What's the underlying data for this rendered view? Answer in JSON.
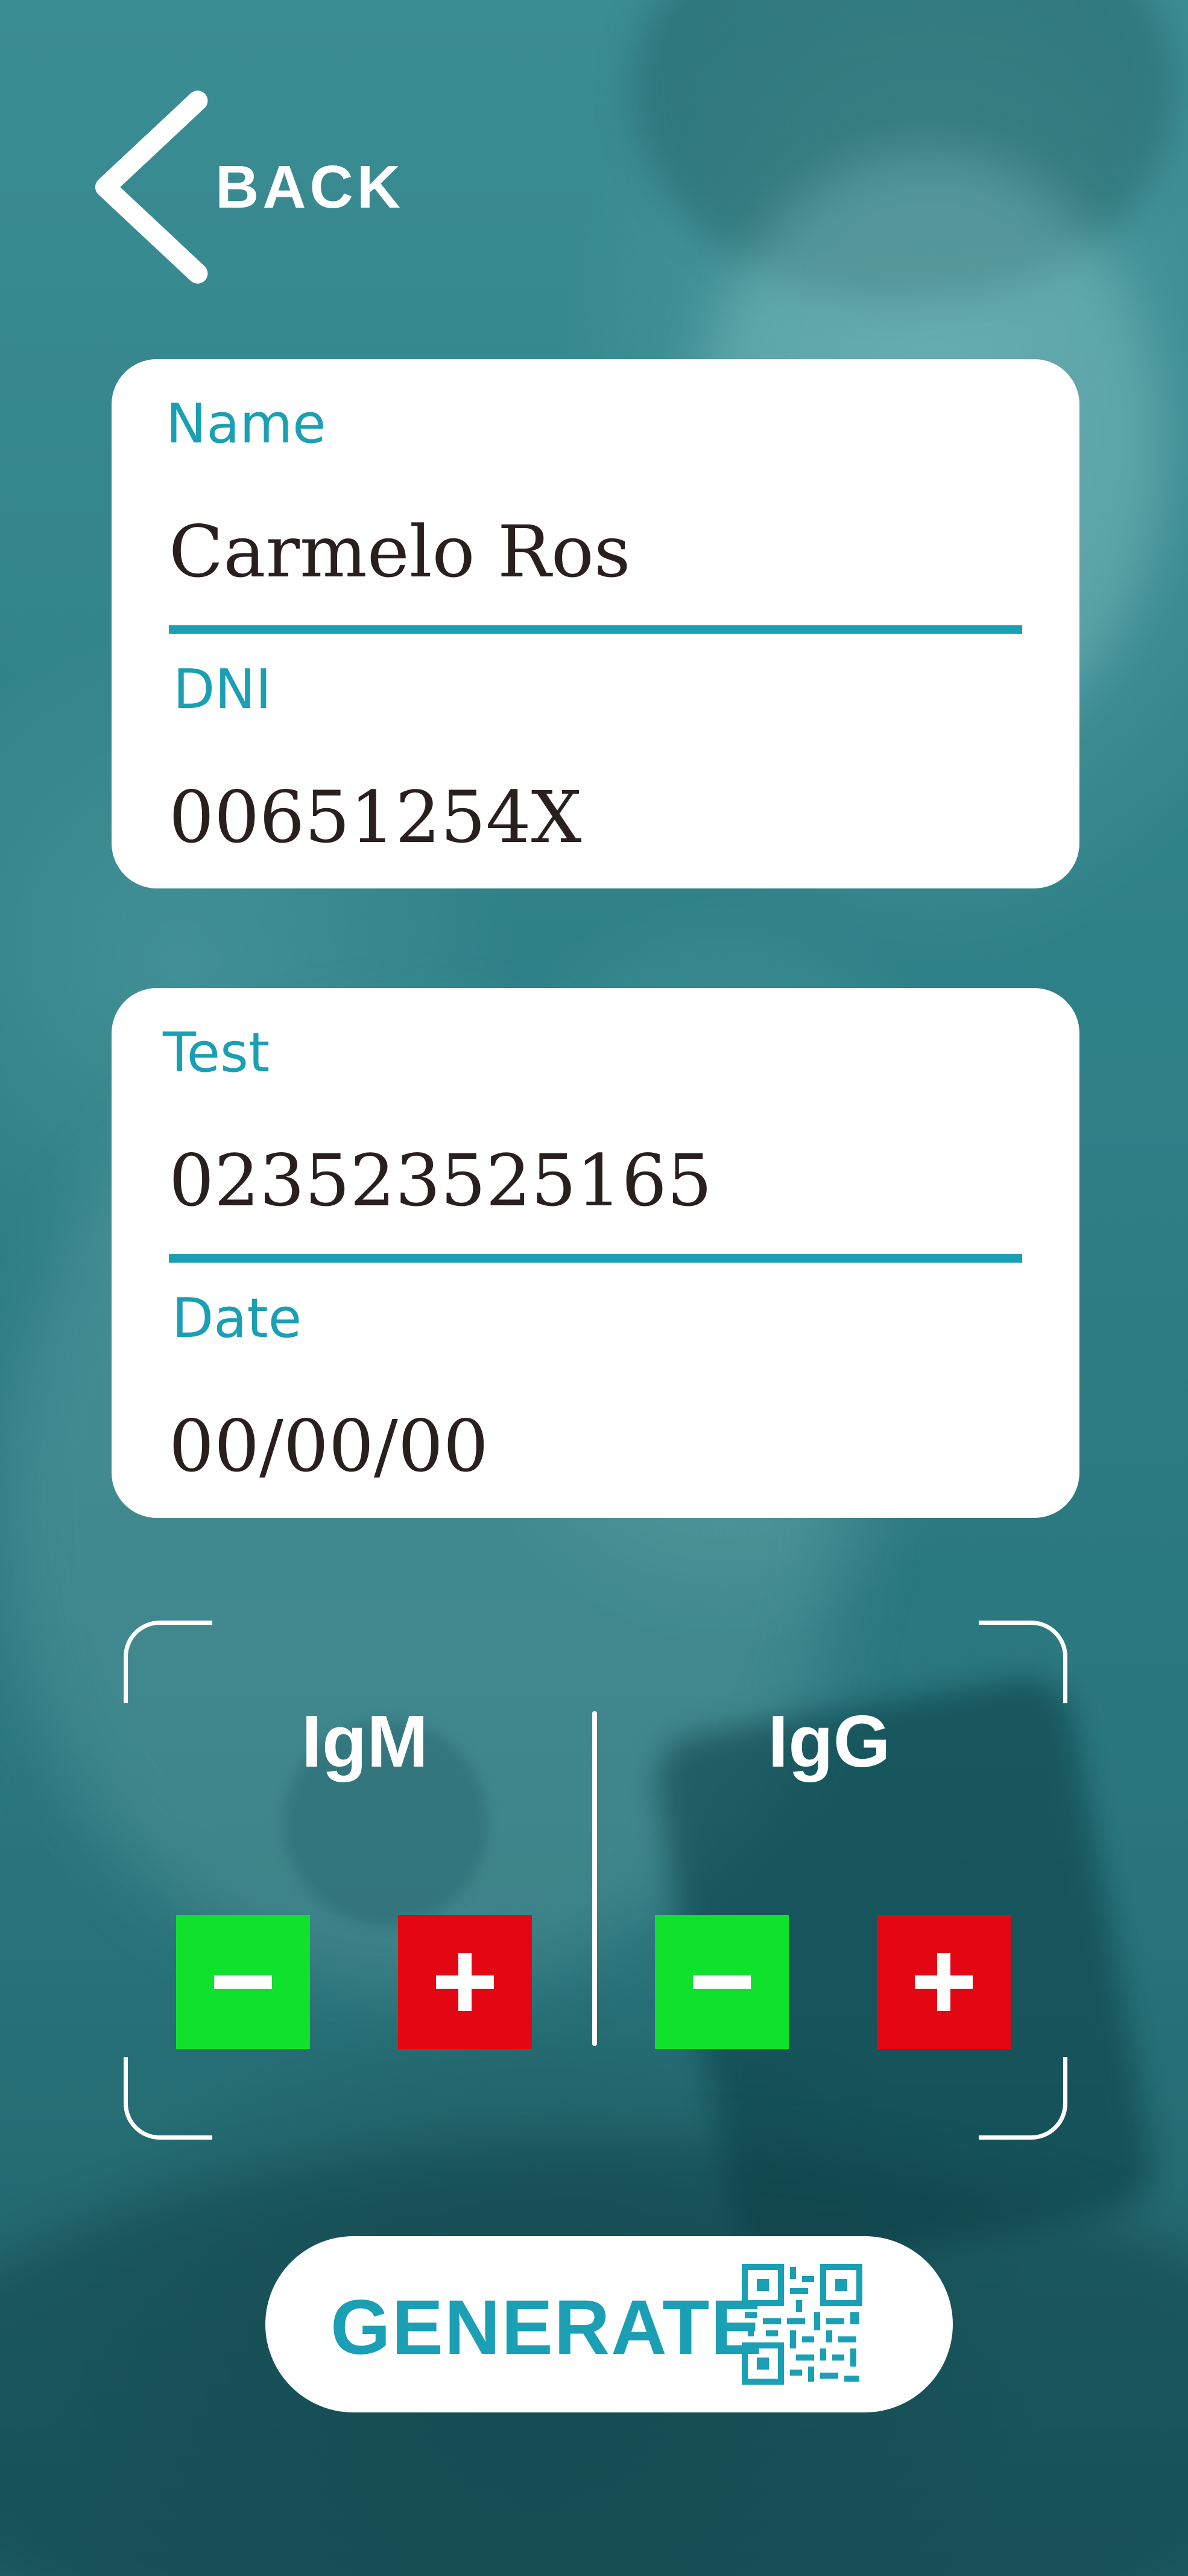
{
  "header": {
    "back_label": "BACK"
  },
  "patient": {
    "name_label": "Name",
    "name_value": "Carmelo Ros",
    "dni_label": "DNI",
    "dni_value": "00651254X"
  },
  "test": {
    "test_label": "Test",
    "test_value": "023523525165",
    "date_label": "Date",
    "date_value": "00/00/00"
  },
  "antibodies": {
    "igm": {
      "title": "IgM",
      "negative_icon": "minus-icon",
      "positive_icon": "plus-icon"
    },
    "igg": {
      "title": "IgG",
      "negative_icon": "minus-icon",
      "positive_icon": "plus-icon"
    }
  },
  "generate": {
    "label": "GENERATE",
    "icon": "qr-code-icon"
  },
  "colors": {
    "accent": "#1a9fb4",
    "negative": "#0fe12d",
    "positive": "#e30613",
    "background": "#2c7c82"
  }
}
